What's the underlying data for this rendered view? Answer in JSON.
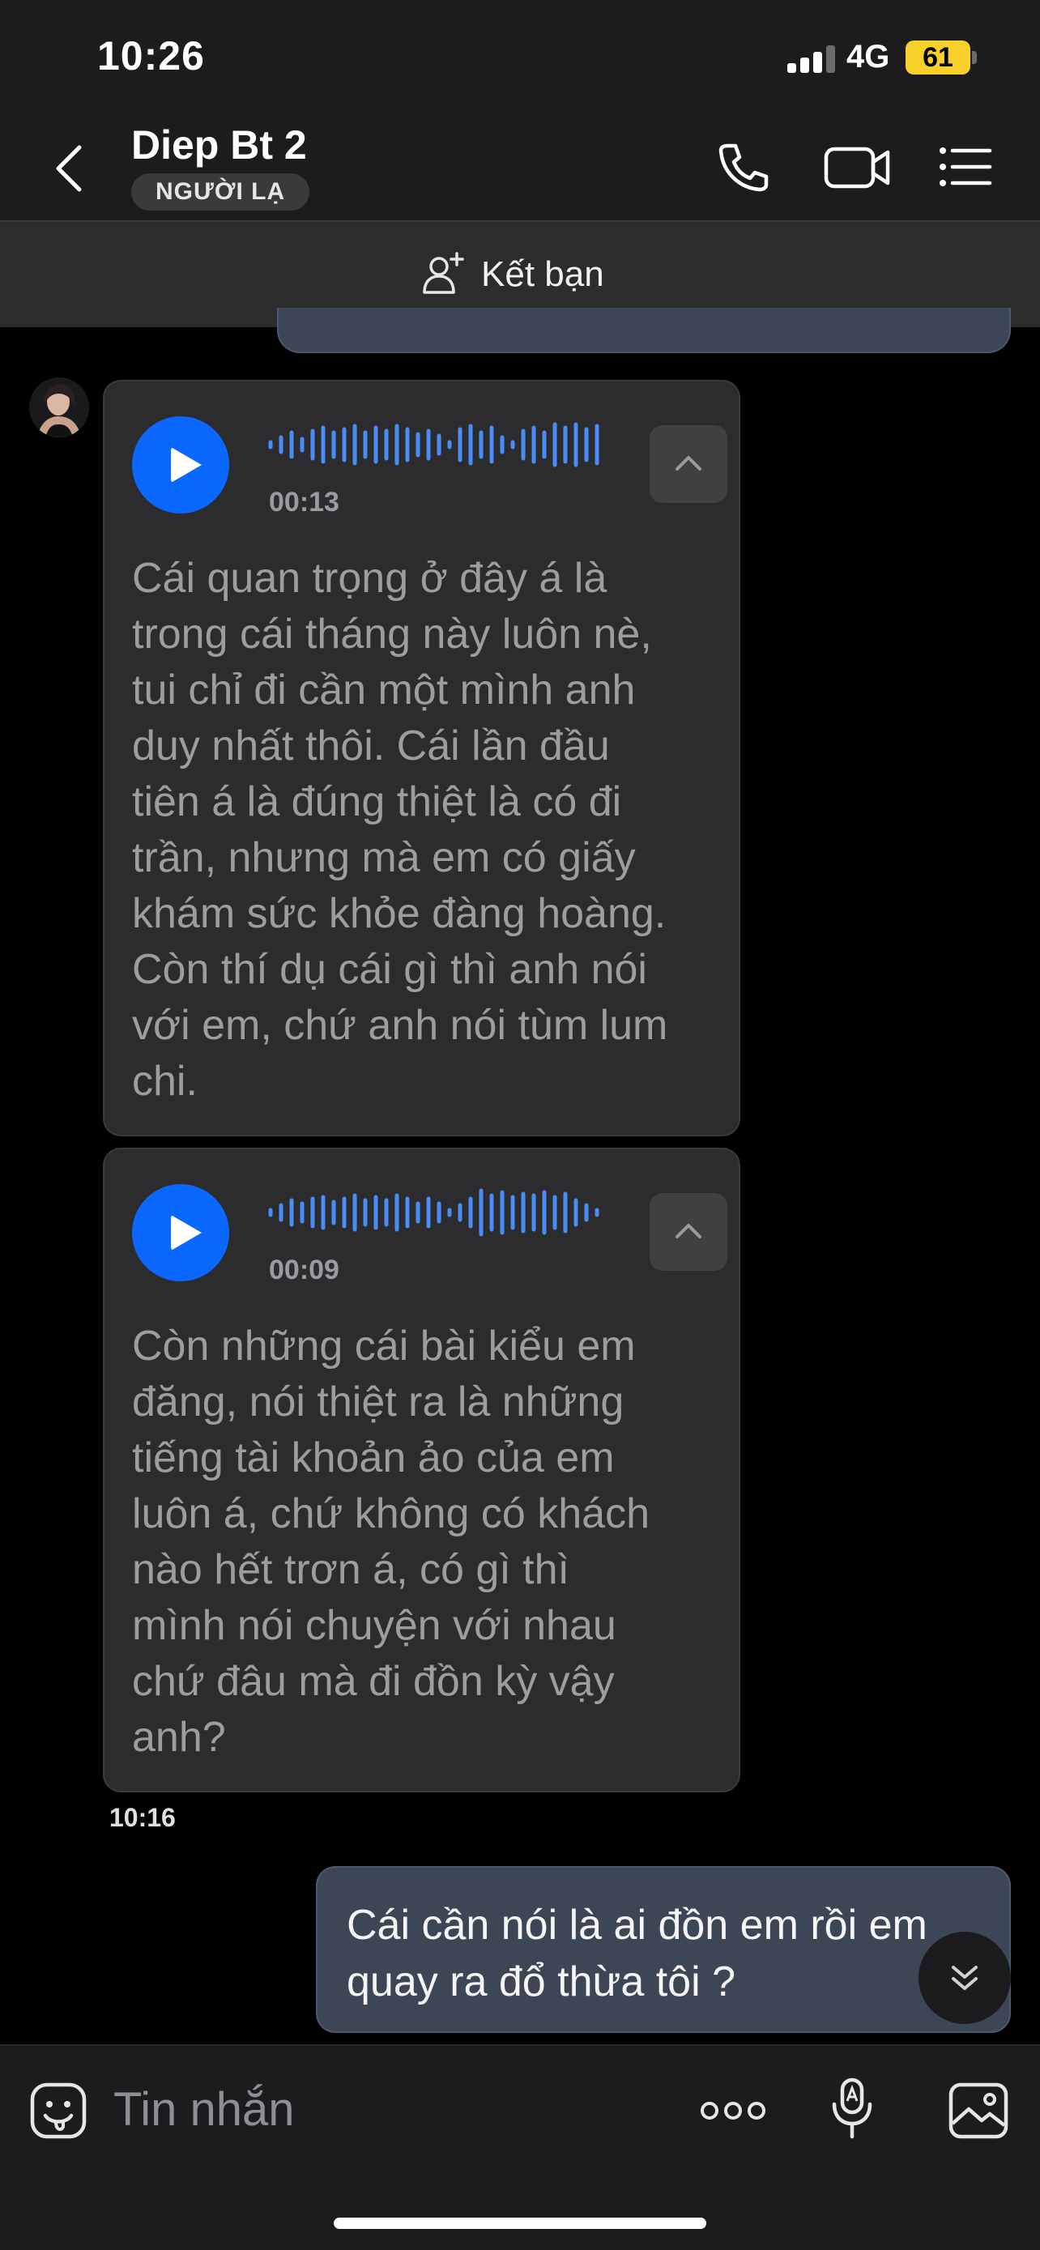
{
  "status_bar": {
    "time": "10:26",
    "network": "4G",
    "battery": "61"
  },
  "header": {
    "contact_name": "Diep Bt 2",
    "badge": "NGƯỜI LẠ",
    "icons": [
      "back-icon",
      "phone-icon",
      "video-call-icon",
      "menu-list-icon"
    ]
  },
  "friend_bar": {
    "label": "Kết bạn",
    "icon": "add-friend-icon"
  },
  "messages": [
    {
      "type": "voice",
      "duration": "00:13",
      "transcript": "Cái quan trọng ở đây á là\ntrong cái tháng này luôn nè,\ntui chỉ đi cần một mình anh\nduy nhất thôi. Cái lần đầu\ntiên á là đúng thiệt là có đi\ntrần, nhưng mà em có giấy\nkhám sức khỏe đàng hoàng.\nCòn thí dụ cái gì thì anh nói\nvới em, chứ anh nói tùm lum\nchi."
    },
    {
      "type": "voice",
      "duration": "00:09",
      "transcript": "Còn những cái bài kiểu em\nđăng, nói thiệt ra là những\ntiếng tài khoản ảo của em\nluôn á, chứ không có khách\nnào hết trơn á, có gì thì\nmình nói chuyện với nhau\nchứ đâu mà đi đồn kỳ vậy\nanh?"
    }
  ],
  "timestamp": "10:16",
  "outgoing": {
    "text": "Cái cần nói là ai đồn em rồi em\nquay ra đổ thừa tôi ?"
  },
  "composer": {
    "placeholder": "Tin nhắn",
    "icons": [
      "sticker-icon",
      "more-icon",
      "voice-to-text-icon",
      "image-icon"
    ]
  },
  "colors": {
    "accent": "#0A68FF",
    "wave": "#4A8CF7",
    "incoming_bubble": "#2C2C2E",
    "outgoing_bubble": "#3D4655",
    "battery": "#F7D02A"
  }
}
